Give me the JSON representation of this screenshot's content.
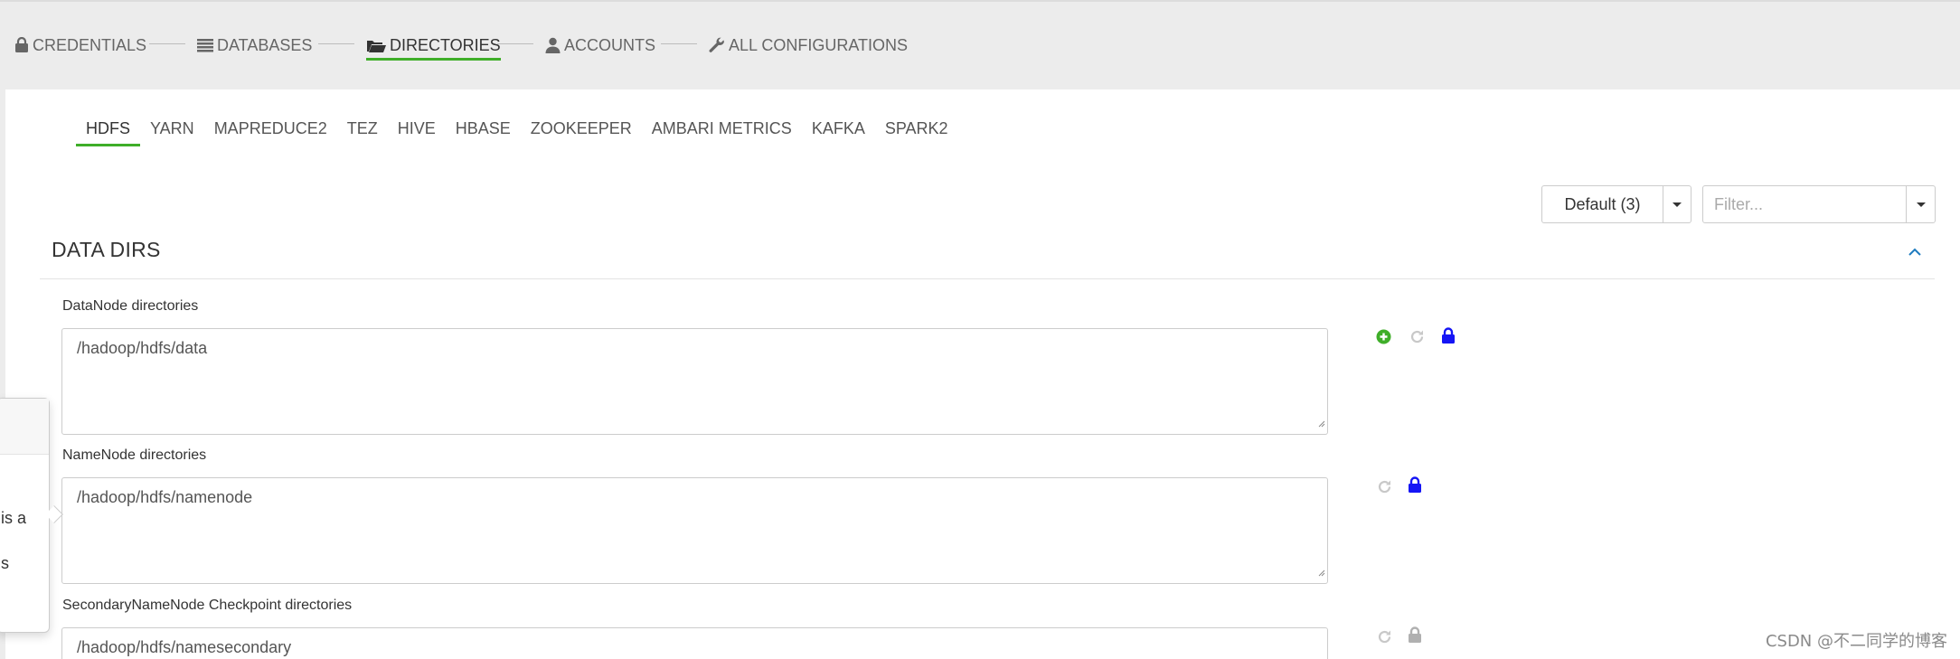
{
  "wizard": {
    "steps": [
      {
        "label": "CREDENTIALS",
        "icon": "lock-icon"
      },
      {
        "label": "DATABASES",
        "icon": "list-icon"
      },
      {
        "label": "DIRECTORIES",
        "icon": "folder-open-icon",
        "active": true
      },
      {
        "label": "ACCOUNTS",
        "icon": "user-icon"
      },
      {
        "label": "ALL CONFIGURATIONS",
        "icon": "wrench-icon"
      }
    ]
  },
  "services": {
    "tabs": [
      "HDFS",
      "YARN",
      "MAPREDUCE2",
      "TEZ",
      "HIVE",
      "HBASE",
      "ZOOKEEPER",
      "AMBARI METRICS",
      "KAFKA",
      "SPARK2"
    ],
    "active": "HDFS"
  },
  "config_group": {
    "label": "Default (3)"
  },
  "filter": {
    "placeholder": "Filter..."
  },
  "section": {
    "title": "DATA DIRS"
  },
  "properties": [
    {
      "label": "DataNode directories",
      "value": "/hadoop/hdfs/data"
    },
    {
      "label": "NameNode directories",
      "value": "/hadoop/hdfs/namenode"
    },
    {
      "label": "SecondaryNameNode Checkpoint directories",
      "value": "/hadoop/hdfs/namesecondary"
    }
  ],
  "popover": {
    "line1": "is a",
    "line2": "s"
  },
  "watermark": "CSDN @不二同学的博客",
  "colors": {
    "accent": "#3fae29",
    "add": "#3fae29",
    "lock_active": "#1515f5",
    "lock_inactive": "#b0b0b0",
    "undo_inactive": "#c8c8c8"
  }
}
